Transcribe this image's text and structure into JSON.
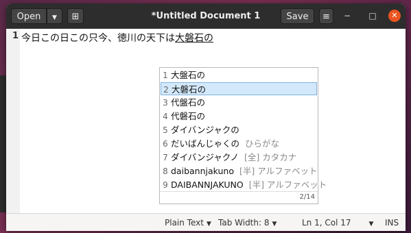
{
  "header": {
    "open_label": "Open",
    "open_arrow": "▼",
    "new_tab_icon": "⊞",
    "title": "*Untitled Document 1",
    "save_label": "Save",
    "menu_icon": "≡",
    "minimize": "−",
    "maximize": "□",
    "close": "✕"
  },
  "editor": {
    "line_number": "1",
    "text_committed": "今日この日この只今、徳川の天下は",
    "text_preedit": "大磐石の"
  },
  "candidates": {
    "items": [
      {
        "num": "1",
        "text": "大盤石の",
        "note": ""
      },
      {
        "num": "2",
        "text": "大磐石の",
        "note": ""
      },
      {
        "num": "3",
        "text": "代盤石の",
        "note": ""
      },
      {
        "num": "4",
        "text": "代磐石の",
        "note": ""
      },
      {
        "num": "5",
        "text": "ダイバンジャクの",
        "note": ""
      },
      {
        "num": "6",
        "text": "だいばんじゃくの",
        "note": "ひらがな"
      },
      {
        "num": "7",
        "text": "ダイバンジャクノ",
        "note": "[全] カタカナ"
      },
      {
        "num": "8",
        "text": "daibannjakuno",
        "note": "[半] アルファベット"
      },
      {
        "num": "9",
        "text": "DAIBANNJAKUNO",
        "note": "[半] アルファベット"
      }
    ],
    "selected_index": 1,
    "page": "2/14"
  },
  "statusbar": {
    "language": "Plain Text",
    "tab_width": "Tab Width: 8",
    "position": "Ln 1, Col 17",
    "mode": "INS",
    "caret": "▼"
  }
}
